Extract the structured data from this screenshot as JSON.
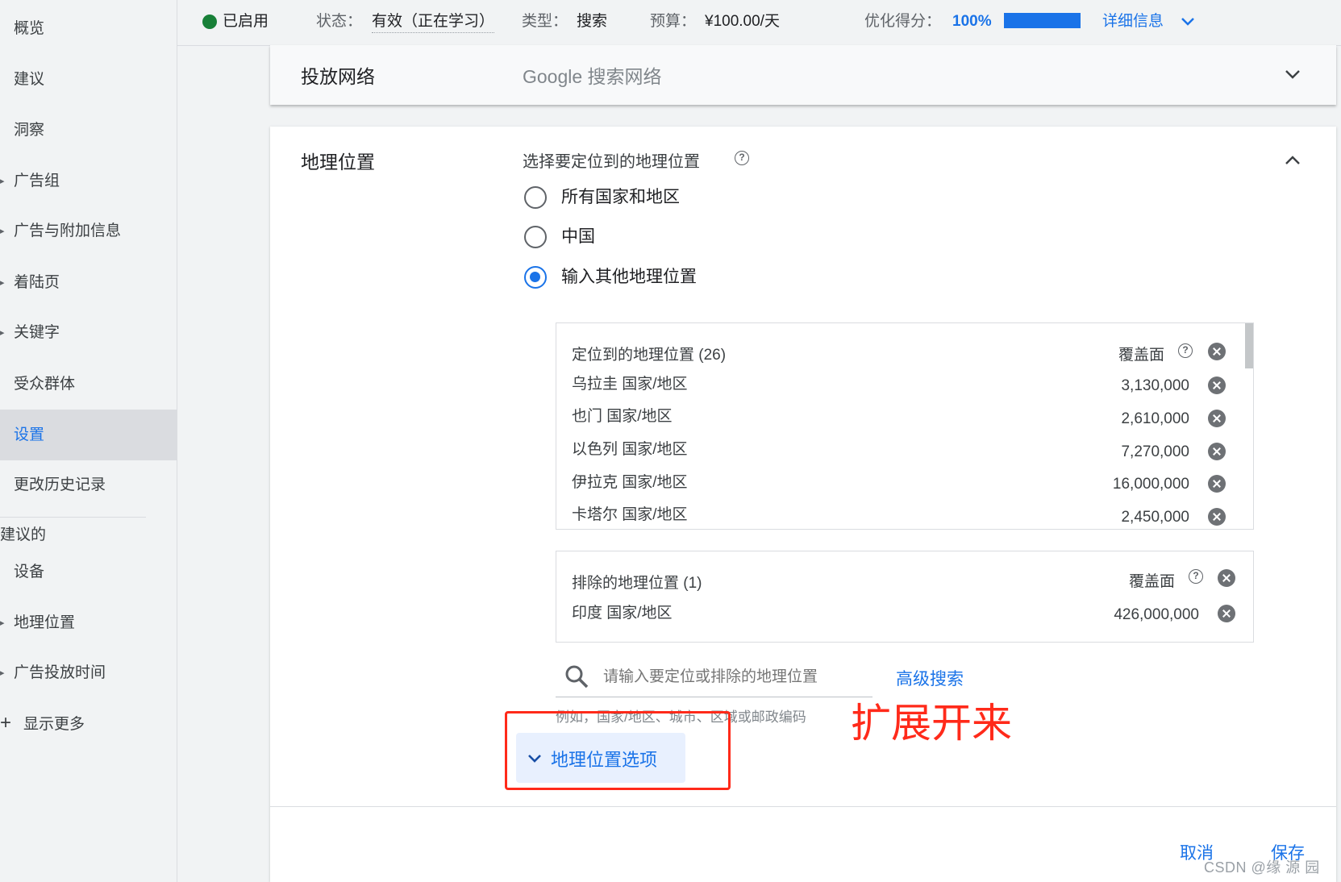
{
  "sidebar": {
    "items": [
      {
        "label": "概览",
        "arrow": false
      },
      {
        "label": "建议",
        "arrow": false
      },
      {
        "label": "洞察",
        "arrow": false
      },
      {
        "label": "广告组",
        "arrow": true
      },
      {
        "label": "广告与附加信息",
        "arrow": true
      },
      {
        "label": "着陆页",
        "arrow": true
      },
      {
        "label": "关键字",
        "arrow": true
      },
      {
        "label": "受众群体",
        "arrow": false
      },
      {
        "label": "设置",
        "arrow": false,
        "active": true
      },
      {
        "label": "更改历史记录",
        "arrow": false
      }
    ],
    "section_title": "建议的",
    "sub_items": [
      {
        "label": "设备",
        "arrow": false
      },
      {
        "label": "地理位置",
        "arrow": true
      },
      {
        "label": "广告投放时间",
        "arrow": true
      }
    ],
    "show_more": "显示更多"
  },
  "topbar": {
    "enabled_label": "已启用",
    "status_label": "状态：",
    "status_value": "有效（正在学习）",
    "type_label": "类型：",
    "type_value": "搜索",
    "budget_label": "预算：",
    "budget_value": "¥100.00/天",
    "score_label": "优化得分：",
    "score_value": "100%",
    "score_fraction": 1.0,
    "details_label": "详细信息"
  },
  "network_section": {
    "title": "投放网络",
    "value": "Google 搜索网络"
  },
  "geo_section": {
    "title": "地理位置",
    "prompt": "选择要定位到的地理位置",
    "options": [
      {
        "label": "所有国家和地区",
        "checked": false
      },
      {
        "label": "中国",
        "checked": false
      },
      {
        "label": "输入其他地理位置",
        "checked": true
      }
    ],
    "targeted": {
      "header": "定位到的地理位置 (26)",
      "reach_label": "覆盖面",
      "rows": [
        {
          "name": "乌拉圭 国家/地区",
          "reach": "3,130,000"
        },
        {
          "name": "也门 国家/地区",
          "reach": "2,610,000"
        },
        {
          "name": "以色列 国家/地区",
          "reach": "7,270,000"
        },
        {
          "name": "伊拉克 国家/地区",
          "reach": "16,000,000"
        },
        {
          "name": "卡塔尔 国家/地区",
          "reach": "2,450,000"
        }
      ]
    },
    "excluded": {
      "header": "排除的地理位置 (1)",
      "reach_label": "覆盖面",
      "rows": [
        {
          "name": "印度 国家/地区",
          "reach": "426,000,000"
        }
      ]
    },
    "search": {
      "placeholder": "请输入要定位或排除的地理位置",
      "advanced": "高级搜索",
      "hint": "例如，国家/地区、城市、区域或邮政编码"
    },
    "options_toggle": "地理位置选项"
  },
  "annotation": "扩展开来",
  "actions": {
    "cancel": "取消",
    "save": "保存"
  },
  "watermark": "CSDN @缘 源 园",
  "colors": {
    "accent": "#1a73e8",
    "status_green": "#188038",
    "annotation_red": "#ff2a1a"
  }
}
